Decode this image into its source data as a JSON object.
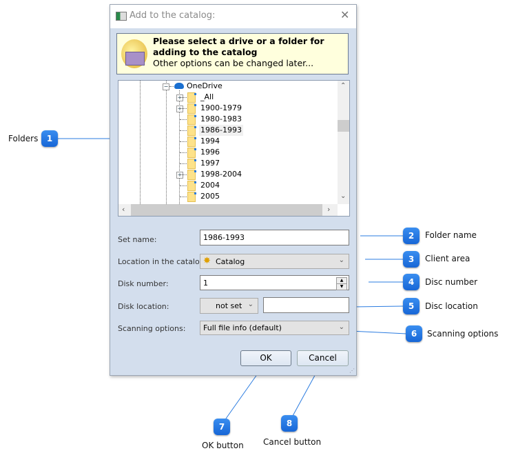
{
  "dialog": {
    "title": "Add to the catalog:",
    "close_icon": "close-icon",
    "banner": {
      "heading": "Please select a drive or a folder for adding to the catalog",
      "subtext": "Other options can be changed later..."
    },
    "tree": {
      "root": "OneDrive",
      "items": [
        {
          "label": "_All",
          "expandable": true
        },
        {
          "label": "1900-1979",
          "expandable": true
        },
        {
          "label": "1980-1983",
          "expandable": false
        },
        {
          "label": "1986-1993",
          "expandable": false,
          "selected": true
        },
        {
          "label": "1994",
          "expandable": false
        },
        {
          "label": "1996",
          "expandable": false
        },
        {
          "label": "1997",
          "expandable": false
        },
        {
          "label": "1998-2004",
          "expandable": true
        },
        {
          "label": "2004",
          "expandable": false
        },
        {
          "label": "2005",
          "expandable": false
        }
      ]
    },
    "form": {
      "set_name_label": "Set name:",
      "set_name_value": "1986-1993",
      "location_label": "Location in the catalog:",
      "location_value": "Catalog",
      "disk_number_label": "Disk number:",
      "disk_number_value": "1",
      "disk_location_label": "Disk location:",
      "disk_location_value": "not set",
      "disk_location_text": "",
      "scanning_label": "Scanning options:",
      "scanning_value": "Full file info (default)"
    },
    "buttons": {
      "ok": "OK",
      "cancel": "Cancel"
    }
  },
  "callouts": [
    {
      "n": "1",
      "label": "Folders"
    },
    {
      "n": "2",
      "label": "Folder name"
    },
    {
      "n": "3",
      "label": "Client area"
    },
    {
      "n": "4",
      "label": "Disc number"
    },
    {
      "n": "5",
      "label": "Disc location"
    },
    {
      "n": "6",
      "label": "Scanning options"
    },
    {
      "n": "7",
      "label": "OK button"
    },
    {
      "n": "8",
      "label": "Cancel button"
    }
  ],
  "colors": {
    "callout": "#1a6fe0",
    "dialog_bg": "#d3deed",
    "banner_bg": "#ffffdd"
  }
}
